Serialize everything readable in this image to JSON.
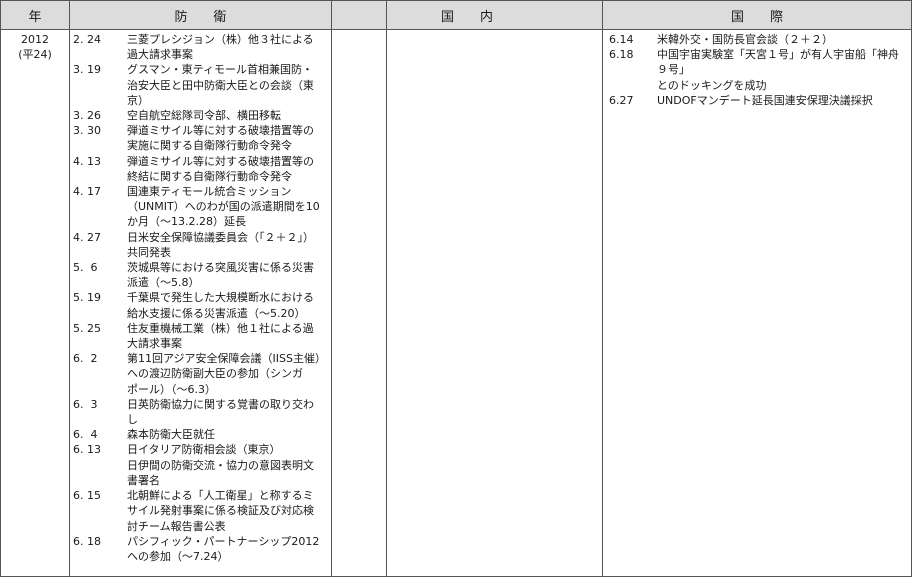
{
  "headers": {
    "year": "年",
    "defense": "防　　衛",
    "domestic": "国　　内",
    "international": "国　　際"
  },
  "year": {
    "western": "2012",
    "japanese": "(平24)"
  },
  "defense_entries": [
    {
      "date": "2. 24",
      "text": "三菱プレシジョン（株）他３社による\n過大請求事案"
    },
    {
      "date": "3. 19",
      "text": "グスマン・東ティモール首相兼国防・\n治安大臣と田中防衛大臣との会談（東\n京）"
    },
    {
      "date": "3. 26",
      "text": "空自航空総隊司令部、横田移転"
    },
    {
      "date": "3. 30",
      "text": "弾道ミサイル等に対する破壊措置等の\n実施に関する自衛隊行動命令発令"
    },
    {
      "date": "4. 13",
      "text": "弾道ミサイル等に対する破壊措置等の\n終結に関する自衛隊行動命令発令"
    },
    {
      "date": "4. 17",
      "text": "国連東ティモール統合ミッション\n（UNMIT）へのわが国の派遣期間を10\nか月（～13.2.28）延長"
    },
    {
      "date": "4. 27",
      "text": "日米安全保障協議委員会（「２＋２」）\n共同発表"
    },
    {
      "date": "5.  6",
      "text": "茨城県等における突風災害に係る災害\n派遣（～5.8）"
    },
    {
      "date": "5. 19",
      "text": "千葉県で発生した大規模断水における\n給水支援に係る災害派遣（～5.20）"
    },
    {
      "date": "5. 25",
      "text": "住友重機械工業（株）他１社による過\n大請求事案"
    },
    {
      "date": "6.  2",
      "text": "第11回アジア安全保障会議（IISS主催）\nへの渡辺防衛副大臣の参加（シンガ\nポール）（～6.3）"
    },
    {
      "date": "6.  3",
      "text": "日英防衛協力に関する覚書の取り交わ\nし"
    },
    {
      "date": "6.  4",
      "text": "森本防衛大臣就任"
    },
    {
      "date": "6. 13",
      "text": "日イタリア防衛相会談（東京）\n日伊間の防衛交流・協力の意図表明文\n書署名"
    },
    {
      "date": "6. 15",
      "text": "北朝鮮による「人工衛星」と称するミ\nサイル発射事案に係る検証及び対応検\n討チーム報告書公表"
    },
    {
      "date": "6. 18",
      "text": "パシフィック・パートナーシップ2012\nへの参加（～7.24）"
    }
  ],
  "domestic_entries": [],
  "international_entries": [
    {
      "date": "6.14",
      "text": "米韓外交・国防長官会談（２＋２）"
    },
    {
      "date": "6.18",
      "text": "中国宇宙実験室「天宮１号」が有人宇宙船「神舟９号」\nとのドッキングを成功"
    },
    {
      "date": "6.27",
      "text": "UNDOFマンデート延長国連安保理決議採択"
    }
  ]
}
